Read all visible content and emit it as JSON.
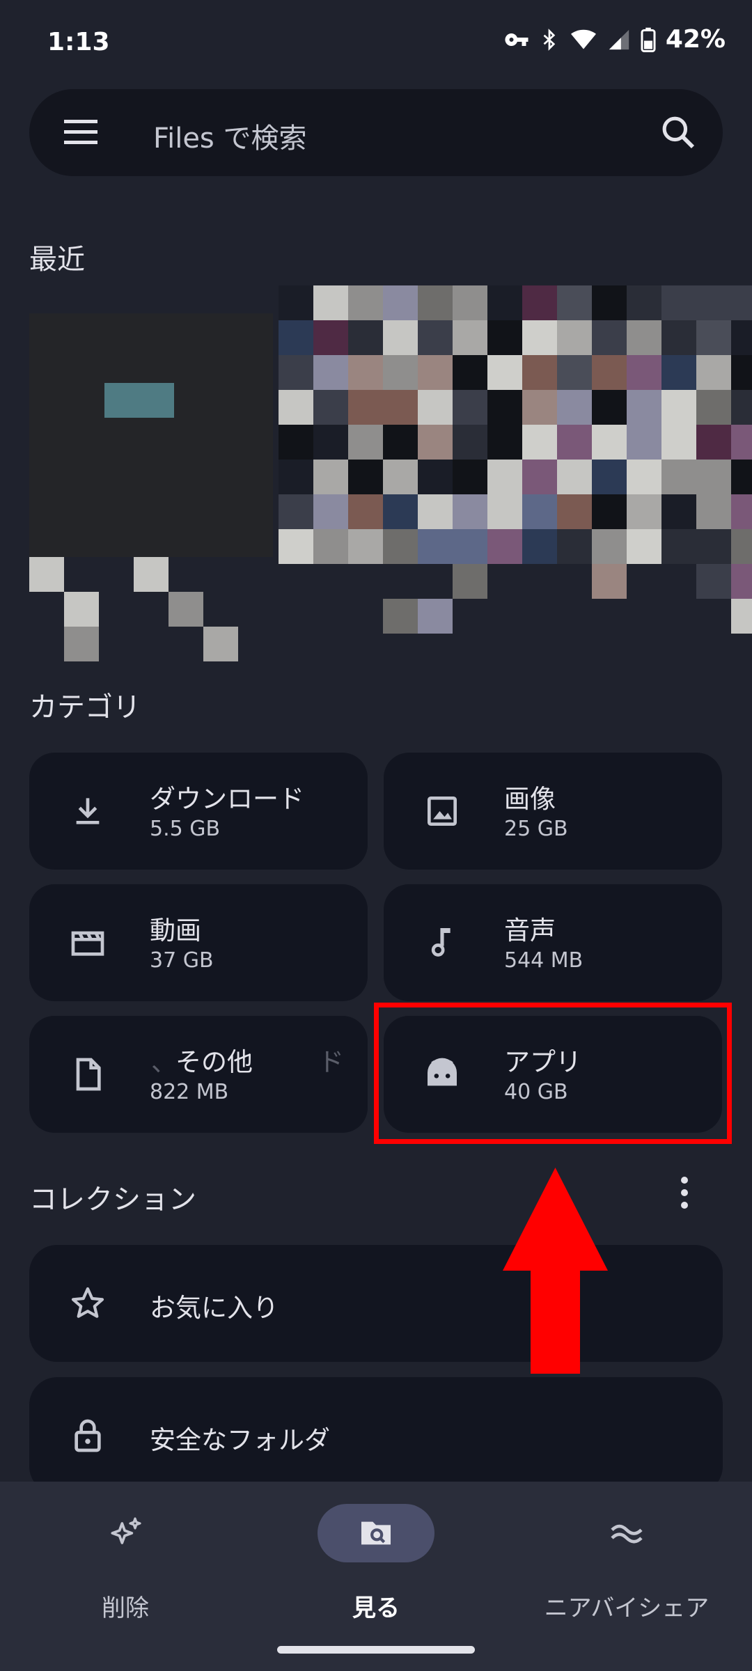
{
  "status_bar": {
    "time": "1:13",
    "battery": "42%"
  },
  "search": {
    "placeholder": "Files で検索"
  },
  "recent": {
    "title": "最近"
  },
  "categories": {
    "title": "カテゴリ",
    "items": [
      {
        "name": "ダウンロード",
        "size": "5.5 GB",
        "icon": "download-icon"
      },
      {
        "name": "画像",
        "size": "25 GB",
        "icon": "image-icon"
      },
      {
        "name": "動画",
        "size": "37 GB",
        "icon": "movie-icon"
      },
      {
        "name": "音声",
        "size": "544 MB",
        "icon": "music-note-icon"
      },
      {
        "name": "その他",
        "size": "822 MB",
        "icon": "document-icon"
      },
      {
        "name": "アプリ",
        "size": "40 GB",
        "icon": "android-icon"
      }
    ]
  },
  "collections": {
    "title": "コレクション",
    "items": [
      {
        "name": "お気に入り",
        "icon": "star-icon"
      },
      {
        "name": "安全なフォルダ",
        "icon": "lock-icon"
      }
    ]
  },
  "bottom_nav": {
    "items": [
      {
        "label": "削除",
        "icon": "sparkle-icon",
        "active": false
      },
      {
        "label": "見る",
        "icon": "browse-folder-icon",
        "active": true
      },
      {
        "label": "ニアバイシェア",
        "icon": "nearby-share-icon",
        "active": false
      }
    ]
  },
  "colors": {
    "background": "#1f222d",
    "card": "#121520",
    "highlight_annotation": "#ff0000",
    "active_nav_pill": "#4b4f6b"
  }
}
